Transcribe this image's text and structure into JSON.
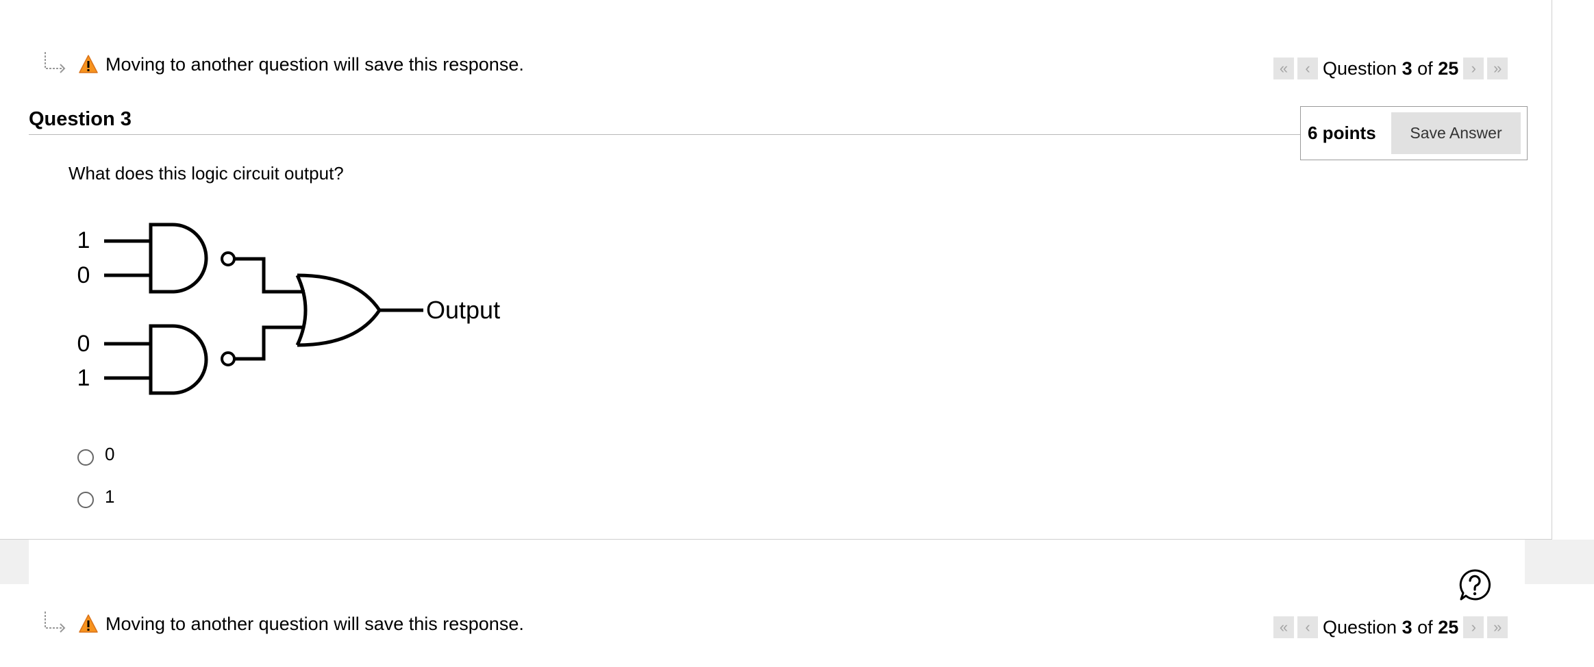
{
  "notice": {
    "text": "Moving to another question will save this response."
  },
  "pager": {
    "prefix": "Question",
    "current": "3",
    "of": "of",
    "total": "25",
    "first": "«",
    "prev": "‹",
    "next": "›",
    "last": "»"
  },
  "question": {
    "title": "Question 3",
    "points": "6 points",
    "save_label": "Save Answer",
    "text": "What does this logic circuit output?"
  },
  "diagram": {
    "inputs_top": [
      "1",
      "0"
    ],
    "inputs_bottom": [
      "0",
      "1"
    ],
    "output_label": "Output"
  },
  "options": [
    "0",
    "1"
  ],
  "icons": {
    "arrow": "return-arrow-icon",
    "warning": "warning-icon",
    "help": "help-icon"
  },
  "colors": {
    "warning": "#f7931e",
    "button_bg": "#e1e1e1"
  }
}
